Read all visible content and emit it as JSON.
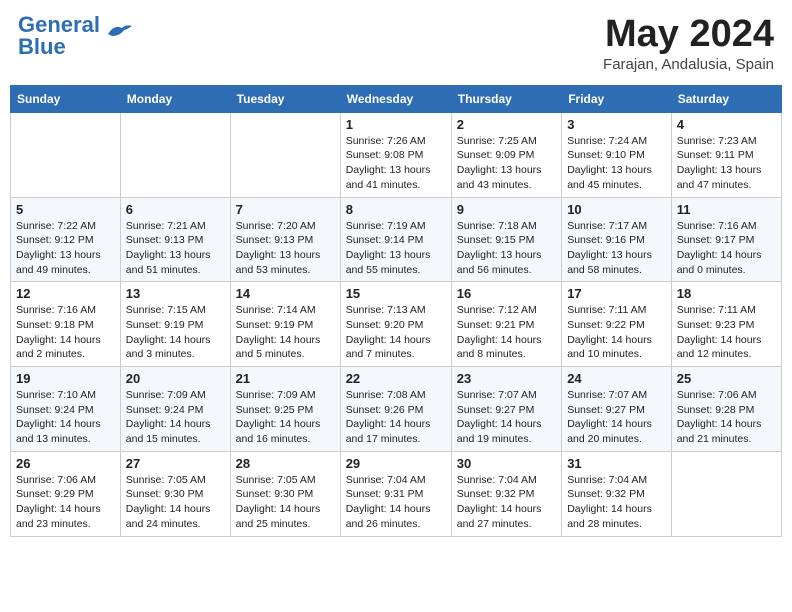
{
  "header": {
    "logo_line1": "General",
    "logo_line2": "Blue",
    "month": "May 2024",
    "location": "Farajan, Andalusia, Spain"
  },
  "weekdays": [
    "Sunday",
    "Monday",
    "Tuesday",
    "Wednesday",
    "Thursday",
    "Friday",
    "Saturday"
  ],
  "weeks": [
    [
      {
        "day": "",
        "sunrise": "",
        "sunset": "",
        "daylight": ""
      },
      {
        "day": "",
        "sunrise": "",
        "sunset": "",
        "daylight": ""
      },
      {
        "day": "",
        "sunrise": "",
        "sunset": "",
        "daylight": ""
      },
      {
        "day": "1",
        "sunrise": "Sunrise: 7:26 AM",
        "sunset": "Sunset: 9:08 PM",
        "daylight": "Daylight: 13 hours and 41 minutes."
      },
      {
        "day": "2",
        "sunrise": "Sunrise: 7:25 AM",
        "sunset": "Sunset: 9:09 PM",
        "daylight": "Daylight: 13 hours and 43 minutes."
      },
      {
        "day": "3",
        "sunrise": "Sunrise: 7:24 AM",
        "sunset": "Sunset: 9:10 PM",
        "daylight": "Daylight: 13 hours and 45 minutes."
      },
      {
        "day": "4",
        "sunrise": "Sunrise: 7:23 AM",
        "sunset": "Sunset: 9:11 PM",
        "daylight": "Daylight: 13 hours and 47 minutes."
      }
    ],
    [
      {
        "day": "5",
        "sunrise": "Sunrise: 7:22 AM",
        "sunset": "Sunset: 9:12 PM",
        "daylight": "Daylight: 13 hours and 49 minutes."
      },
      {
        "day": "6",
        "sunrise": "Sunrise: 7:21 AM",
        "sunset": "Sunset: 9:13 PM",
        "daylight": "Daylight: 13 hours and 51 minutes."
      },
      {
        "day": "7",
        "sunrise": "Sunrise: 7:20 AM",
        "sunset": "Sunset: 9:13 PM",
        "daylight": "Daylight: 13 hours and 53 minutes."
      },
      {
        "day": "8",
        "sunrise": "Sunrise: 7:19 AM",
        "sunset": "Sunset: 9:14 PM",
        "daylight": "Daylight: 13 hours and 55 minutes."
      },
      {
        "day": "9",
        "sunrise": "Sunrise: 7:18 AM",
        "sunset": "Sunset: 9:15 PM",
        "daylight": "Daylight: 13 hours and 56 minutes."
      },
      {
        "day": "10",
        "sunrise": "Sunrise: 7:17 AM",
        "sunset": "Sunset: 9:16 PM",
        "daylight": "Daylight: 13 hours and 58 minutes."
      },
      {
        "day": "11",
        "sunrise": "Sunrise: 7:16 AM",
        "sunset": "Sunset: 9:17 PM",
        "daylight": "Daylight: 14 hours and 0 minutes."
      }
    ],
    [
      {
        "day": "12",
        "sunrise": "Sunrise: 7:16 AM",
        "sunset": "Sunset: 9:18 PM",
        "daylight": "Daylight: 14 hours and 2 minutes."
      },
      {
        "day": "13",
        "sunrise": "Sunrise: 7:15 AM",
        "sunset": "Sunset: 9:19 PM",
        "daylight": "Daylight: 14 hours and 3 minutes."
      },
      {
        "day": "14",
        "sunrise": "Sunrise: 7:14 AM",
        "sunset": "Sunset: 9:19 PM",
        "daylight": "Daylight: 14 hours and 5 minutes."
      },
      {
        "day": "15",
        "sunrise": "Sunrise: 7:13 AM",
        "sunset": "Sunset: 9:20 PM",
        "daylight": "Daylight: 14 hours and 7 minutes."
      },
      {
        "day": "16",
        "sunrise": "Sunrise: 7:12 AM",
        "sunset": "Sunset: 9:21 PM",
        "daylight": "Daylight: 14 hours and 8 minutes."
      },
      {
        "day": "17",
        "sunrise": "Sunrise: 7:11 AM",
        "sunset": "Sunset: 9:22 PM",
        "daylight": "Daylight: 14 hours and 10 minutes."
      },
      {
        "day": "18",
        "sunrise": "Sunrise: 7:11 AM",
        "sunset": "Sunset: 9:23 PM",
        "daylight": "Daylight: 14 hours and 12 minutes."
      }
    ],
    [
      {
        "day": "19",
        "sunrise": "Sunrise: 7:10 AM",
        "sunset": "Sunset: 9:24 PM",
        "daylight": "Daylight: 14 hours and 13 minutes."
      },
      {
        "day": "20",
        "sunrise": "Sunrise: 7:09 AM",
        "sunset": "Sunset: 9:24 PM",
        "daylight": "Daylight: 14 hours and 15 minutes."
      },
      {
        "day": "21",
        "sunrise": "Sunrise: 7:09 AM",
        "sunset": "Sunset: 9:25 PM",
        "daylight": "Daylight: 14 hours and 16 minutes."
      },
      {
        "day": "22",
        "sunrise": "Sunrise: 7:08 AM",
        "sunset": "Sunset: 9:26 PM",
        "daylight": "Daylight: 14 hours and 17 minutes."
      },
      {
        "day": "23",
        "sunrise": "Sunrise: 7:07 AM",
        "sunset": "Sunset: 9:27 PM",
        "daylight": "Daylight: 14 hours and 19 minutes."
      },
      {
        "day": "24",
        "sunrise": "Sunrise: 7:07 AM",
        "sunset": "Sunset: 9:27 PM",
        "daylight": "Daylight: 14 hours and 20 minutes."
      },
      {
        "day": "25",
        "sunrise": "Sunrise: 7:06 AM",
        "sunset": "Sunset: 9:28 PM",
        "daylight": "Daylight: 14 hours and 21 minutes."
      }
    ],
    [
      {
        "day": "26",
        "sunrise": "Sunrise: 7:06 AM",
        "sunset": "Sunset: 9:29 PM",
        "daylight": "Daylight: 14 hours and 23 minutes."
      },
      {
        "day": "27",
        "sunrise": "Sunrise: 7:05 AM",
        "sunset": "Sunset: 9:30 PM",
        "daylight": "Daylight: 14 hours and 24 minutes."
      },
      {
        "day": "28",
        "sunrise": "Sunrise: 7:05 AM",
        "sunset": "Sunset: 9:30 PM",
        "daylight": "Daylight: 14 hours and 25 minutes."
      },
      {
        "day": "29",
        "sunrise": "Sunrise: 7:04 AM",
        "sunset": "Sunset: 9:31 PM",
        "daylight": "Daylight: 14 hours and 26 minutes."
      },
      {
        "day": "30",
        "sunrise": "Sunrise: 7:04 AM",
        "sunset": "Sunset: 9:32 PM",
        "daylight": "Daylight: 14 hours and 27 minutes."
      },
      {
        "day": "31",
        "sunrise": "Sunrise: 7:04 AM",
        "sunset": "Sunset: 9:32 PM",
        "daylight": "Daylight: 14 hours and 28 minutes."
      },
      {
        "day": "",
        "sunrise": "",
        "sunset": "",
        "daylight": ""
      }
    ]
  ]
}
